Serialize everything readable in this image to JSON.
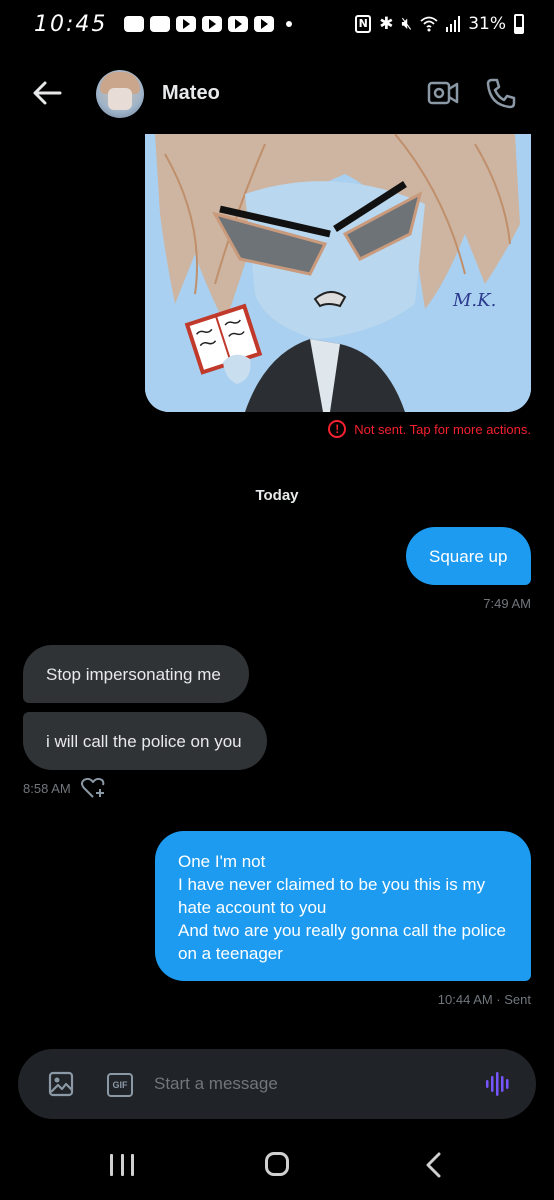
{
  "status_bar": {
    "time": "10:45",
    "battery": "31%"
  },
  "header": {
    "contact_name": "Mateo"
  },
  "image_message": {
    "signature_text": "M.K.",
    "error_text": "Not sent. Tap for more actions."
  },
  "date_separator": "Today",
  "messages": [
    {
      "text": "Square up"
    },
    {
      "text": "Stop impersonating me"
    },
    {
      "text": "i will call the police on you"
    },
    {
      "lines": [
        "One I'm not",
        "I have never claimed to be you this is my",
        "hate account to you",
        "And two are you really gonna call the police",
        "on a teenager"
      ]
    }
  ],
  "timestamps": {
    "sent_1": "7:49 AM",
    "received": "8:58 AM",
    "sent_2": "10:44 AM · Sent"
  },
  "composer": {
    "placeholder": "Start a message",
    "gif_label": "GIF"
  },
  "colors": {
    "accent": "#1d9bf0",
    "received_bubble": "#2f3336",
    "error": "#f4212e",
    "voice": "#7856ff"
  }
}
